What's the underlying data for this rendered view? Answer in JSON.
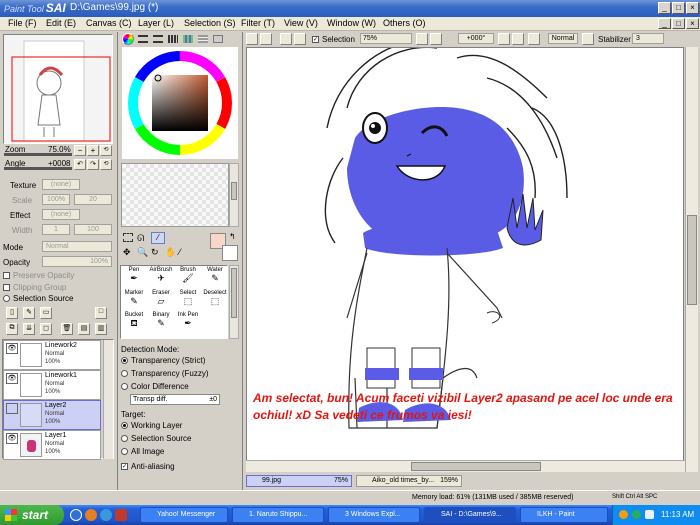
{
  "titlebar": {
    "app_brand": "Paint Tool",
    "app_brand_bold": "SAI",
    "document": "D:\\Games\\99.jpg (*)",
    "win_buttons": [
      "_",
      "□",
      "×"
    ],
    "doc_buttons": [
      "_",
      "□",
      "×"
    ]
  },
  "menu": [
    "File (F)",
    "Edit (E)",
    "Canvas (C)",
    "Layer (L)",
    "Selection (S)",
    "Filter (T)",
    "View (V)",
    "Window (W)",
    "Others (O)"
  ],
  "toolbar": {
    "selection_label": "Selection",
    "zoom": "75%",
    "angle": "+000°",
    "blend": "Normal",
    "stabilizer_label": "Stabilizer",
    "stabilizer_value": "3"
  },
  "navigator": {
    "zoom_label": "Zoom",
    "zoom_value": "75.0%",
    "angle_label": "Angle",
    "angle_value": "+0008"
  },
  "texture": {
    "texture_label": "Texture",
    "texture_value": "(none)",
    "scale_label": "Scale",
    "scale_value": "100%",
    "scale_num": "20",
    "effect_label": "Effect",
    "effect_value": "(none)",
    "width_label": "Width",
    "width_value": "1",
    "width_num": "100"
  },
  "layer_props": {
    "mode_label": "Mode",
    "mode_value": "Normal",
    "opacity_label": "Opacity",
    "opacity_value": "100%",
    "preserve": "Preserve Opacity",
    "clipping": "Clipping Group",
    "selection_source": "Selection Source"
  },
  "layers": [
    {
      "name": "Linework2",
      "mode": "Normal",
      "opacity": "100%",
      "visible": true,
      "selected": false
    },
    {
      "name": "Linework1",
      "mode": "Normal",
      "opacity": "100%",
      "visible": true,
      "selected": false
    },
    {
      "name": "Layer2",
      "mode": "Normal",
      "opacity": "100%",
      "visible": false,
      "selected": true
    },
    {
      "name": "Layer1",
      "mode": "Normal",
      "opacity": "100%",
      "visible": true,
      "selected": false
    }
  ],
  "tools": [
    {
      "label": "Pen",
      "icon": "pen-icon"
    },
    {
      "label": "AirBrush",
      "icon": "airbrush-icon"
    },
    {
      "label": "Brush",
      "icon": "brush-icon"
    },
    {
      "label": "Water",
      "icon": "water-icon"
    },
    {
      "label": "Marker",
      "icon": "marker-icon"
    },
    {
      "label": "Eraser",
      "icon": "eraser-icon"
    },
    {
      "label": "Select",
      "icon": "select-icon"
    },
    {
      "label": "Deselect",
      "icon": "deselect-icon"
    },
    {
      "label": "Bucket",
      "icon": "bucket-icon"
    },
    {
      "label": "Binary",
      "icon": "binary-icon"
    },
    {
      "label": "Ink Pen",
      "icon": "ink-pen-icon"
    },
    {
      "label": "",
      "icon": "blank"
    }
  ],
  "selection_options": {
    "mode_label": "Detection Mode:",
    "opt1": "Transparency (Strict)",
    "opt2": "Transparency (Fuzzy)",
    "opt3": "Color Difference",
    "transp_label": "Transp diff.",
    "transp_value": "±0",
    "target_label": "Target:",
    "t1": "Working Layer",
    "t2": "Selection Source",
    "t3": "All Image",
    "antialias": "Anti-aliasing"
  },
  "canvas_caption": "Am selectat, bun! Acum faceti vizibil Layer2 apasand pe acel loc unde era ochiul! xD Sa vedeti ce frumos va iesi!",
  "doc_tabs": [
    {
      "name": "99.jpg",
      "zoom": "75%"
    },
    {
      "name": "Aiko_old times_by...",
      "zoom": "159%"
    }
  ],
  "status": {
    "memory": "Memory load: 61% (131MB used / 385MB reserved)",
    "keys": "Shift Ctrl Alt SPC"
  },
  "taskbar": {
    "start": "start",
    "tasks": [
      "Yahoo! Messenger",
      "1. Naruto Shippu...",
      "3 Windows Expl...",
      "SAI - D:\\Games\\9...",
      "ILKH - Paint"
    ],
    "clock": "11:13 AM"
  },
  "colors": {
    "selection_fill": "#5a5ce6",
    "caption": "#e3160f",
    "taskbar": "#245edb",
    "layer_selected": "#cdd0f5"
  }
}
